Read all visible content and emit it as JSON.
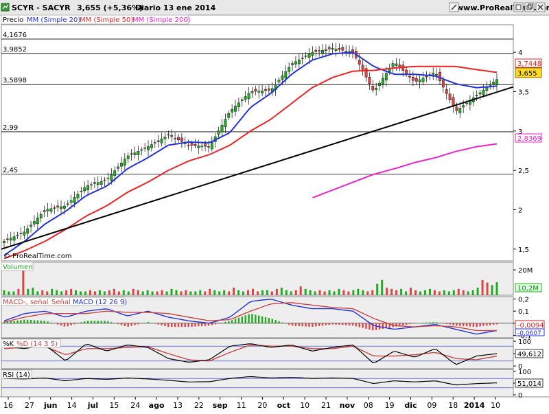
{
  "header": {
    "symbol": "SCYR - SACYR",
    "price_change": "3,655 (+5,36%)",
    "period_date": "Diario  13 ene 2014",
    "site": "www.ProRealTime.com",
    "icons": [
      "edit-pencil-icon",
      "window-icon",
      "restore-icon",
      "close-icon"
    ]
  },
  "legend": {
    "precio": "Precio",
    "mm20": "MM (Simple 20)",
    "mm50": "MM (Simple 50)",
    "mm200": "MM (Simple 200)"
  },
  "colors": {
    "up_candle": "#22aa22",
    "down_candle": "#dd4444",
    "mm20": "#2233dd",
    "mm50": "#ee2222",
    "mm200": "#ee22cc",
    "trendline": "#000000",
    "panel_bg": "#eeeeee"
  },
  "price_panel": {
    "level_labels": [
      "4,1676",
      "3,9852",
      "3,5898",
      "2,99",
      "2,45"
    ],
    "axis_ticks": [
      "4",
      "3,5",
      "3",
      "2,5",
      "2",
      "1,5"
    ],
    "badges": {
      "mm50": "3,7448",
      "price": "3,655",
      "mm200": "2,8369"
    },
    "copyright": "© ProRealTime.com"
  },
  "volume_panel": {
    "title": "Volumen",
    "axis_ticks": [
      "20M"
    ],
    "value_badge": "10,2M"
  },
  "macd_panel": {
    "title_macd": "MACD-, señal",
    "title_signal": "Señal",
    "title_main": "MACD (12 26 9)",
    "axis_ticks": [
      "0,2",
      "0,1",
      "0",
      "-0,1"
    ],
    "badges": [
      "-0,0094",
      "-0,0607"
    ]
  },
  "stoch_panel": {
    "title_k": "%K",
    "title_d": "%D (14 3 5)",
    "axis_ticks": [
      "100",
      "50",
      "0"
    ],
    "value_badge": "49,612"
  },
  "rsi_panel": {
    "title": "RSI (14)",
    "axis_ticks": [
      "100",
      "50",
      "0"
    ],
    "value_badge": "51,014"
  },
  "x_axis_labels": [
    "16",
    "27",
    "jun",
    "14",
    "jul",
    "15",
    "24",
    "ago",
    "13",
    "22",
    "sep",
    "11",
    "20",
    "oct",
    "10",
    "21",
    "nov",
    "08",
    "19",
    "dic",
    "09",
    "18",
    "2014",
    "10"
  ],
  "chart_data": [
    {
      "type": "line",
      "panel": "price",
      "title": "SCYR - SACYR",
      "x": [
        "16 may",
        "27 may",
        "jun",
        "14 jun",
        "jul",
        "15 jul",
        "24 jul",
        "ago",
        "13 ago",
        "22 ago",
        "sep",
        "11 sep",
        "20 sep",
        "oct",
        "10 oct",
        "21 oct",
        "nov",
        "08 nov",
        "19 nov",
        "dic",
        "09 dic",
        "18 dic",
        "2014",
        "10 ene",
        "13 ene"
      ],
      "series": [
        {
          "name": "Precio",
          "values": [
            1.6,
            1.72,
            2.0,
            2.05,
            2.3,
            2.38,
            2.68,
            2.8,
            2.95,
            2.82,
            2.8,
            3.25,
            3.5,
            3.52,
            3.85,
            4.0,
            4.05,
            4.0,
            3.5,
            3.88,
            3.62,
            3.75,
            3.25,
            3.45,
            3.655
          ]
        },
        {
          "name": "MM (Simple 20)",
          "values": [
            1.42,
            1.6,
            1.82,
            1.98,
            2.18,
            2.3,
            2.52,
            2.66,
            2.82,
            2.86,
            2.85,
            2.98,
            3.3,
            3.48,
            3.72,
            3.9,
            3.98,
            4.0,
            3.82,
            3.72,
            3.72,
            3.7,
            3.6,
            3.55,
            3.57
          ]
        },
        {
          "name": "MM (Simple 50)",
          "values": [
            1.38,
            1.48,
            1.6,
            1.75,
            1.92,
            2.05,
            2.22,
            2.35,
            2.5,
            2.62,
            2.7,
            2.82,
            3.0,
            3.15,
            3.35,
            3.55,
            3.68,
            3.76,
            3.77,
            3.8,
            3.82,
            3.82,
            3.82,
            3.78,
            3.7448
          ]
        },
        {
          "name": "MM (Simple 200)",
          "values": [
            null,
            null,
            null,
            null,
            null,
            null,
            null,
            null,
            null,
            null,
            null,
            null,
            null,
            null,
            null,
            2.15,
            2.25,
            2.35,
            2.45,
            2.52,
            2.6,
            2.66,
            2.74,
            2.8,
            2.8369
          ]
        }
      ],
      "levels": [
        4.1676,
        3.9852,
        3.5898,
        2.99,
        2.45
      ],
      "trendline": {
        "from": 1.5,
        "to": 3.56
      },
      "ylim": [
        1.35,
        4.35
      ]
    },
    {
      "type": "bar",
      "panel": "volume",
      "title": "Volumen",
      "values_m": [
        4,
        3,
        3,
        5,
        22,
        5,
        6,
        3,
        4,
        3,
        5,
        4,
        3,
        4,
        5,
        4,
        3,
        3,
        4,
        3,
        4,
        3,
        4,
        5,
        3,
        4,
        3,
        5,
        4,
        3,
        4,
        3,
        3,
        4,
        3,
        5,
        4,
        3,
        4,
        3,
        3,
        4,
        3,
        5,
        4,
        3,
        4,
        3,
        6,
        4,
        3,
        4,
        5,
        3,
        4,
        4,
        3,
        5,
        6,
        4,
        3,
        4,
        7,
        5,
        4,
        3,
        4,
        3,
        4,
        3,
        5,
        4,
        3,
        4,
        5,
        4,
        3,
        4,
        9,
        12,
        6,
        5,
        4,
        5,
        3,
        6,
        4,
        3,
        4,
        5,
        4,
        3,
        4,
        3,
        4,
        5,
        4,
        3,
        4,
        6,
        12,
        10,
        8,
        10.2
      ],
      "axis_ticks": [
        "20M"
      ]
    },
    {
      "type": "line",
      "panel": "macd",
      "title": "MACD (12 26 9)",
      "series": [
        {
          "name": "MACD",
          "values": [
            0.02,
            0.08,
            0.1,
            0.05,
            0.1,
            0.12,
            0.06,
            0.1,
            0.05,
            0.02,
            0.0,
            0.05,
            0.18,
            0.2,
            0.15,
            0.12,
            0.12,
            0.1,
            -0.02,
            -0.05,
            -0.03,
            -0.01,
            -0.05,
            -0.09,
            -0.06
          ]
        },
        {
          "name": "Señal",
          "values": [
            0.01,
            0.05,
            0.08,
            0.08,
            0.08,
            0.1,
            0.09,
            0.09,
            0.08,
            0.05,
            0.02,
            0.03,
            0.1,
            0.16,
            0.17,
            0.15,
            0.13,
            0.12,
            0.04,
            -0.02,
            -0.03,
            -0.02,
            -0.03,
            -0.06,
            -0.0607
          ]
        },
        {
          "name": "MACD-, señal",
          "values": [
            0.01,
            0.03,
            0.02,
            -0.03,
            0.02,
            0.02,
            -0.03,
            0.01,
            -0.03,
            -0.03,
            -0.02,
            0.02,
            0.08,
            0.04,
            -0.02,
            -0.03,
            -0.01,
            -0.02,
            -0.06,
            -0.03,
            0.0,
            0.01,
            -0.02,
            -0.03,
            -0.0094
          ]
        }
      ],
      "ylim": [
        -0.12,
        0.22
      ]
    },
    {
      "type": "line",
      "panel": "stochastic",
      "title": "%D (14 3 5)",
      "series": [
        {
          "name": "%K",
          "values": [
            80,
            70,
            85,
            20,
            90,
            60,
            85,
            75,
            30,
            15,
            25,
            80,
            90,
            75,
            85,
            60,
            75,
            85,
            10,
            60,
            35,
            70,
            5,
            40,
            49.612
          ]
        },
        {
          "name": "%D",
          "values": [
            70,
            75,
            78,
            45,
            70,
            70,
            75,
            78,
            50,
            25,
            20,
            55,
            85,
            80,
            80,
            70,
            70,
            80,
            40,
            40,
            45,
            55,
            30,
            25,
            40
          ]
        }
      ],
      "ylim": [
        0,
        100
      ]
    },
    {
      "type": "line",
      "panel": "rsi",
      "title": "RSI (14)",
      "series": [
        {
          "name": "RSI",
          "values": [
            70,
            68,
            72,
            60,
            70,
            66,
            72,
            68,
            62,
            55,
            56,
            70,
            78,
            72,
            75,
            70,
            72,
            70,
            48,
            60,
            55,
            60,
            42,
            48,
            51.014
          ]
        }
      ],
      "ylim": [
        0,
        100
      ]
    }
  ]
}
